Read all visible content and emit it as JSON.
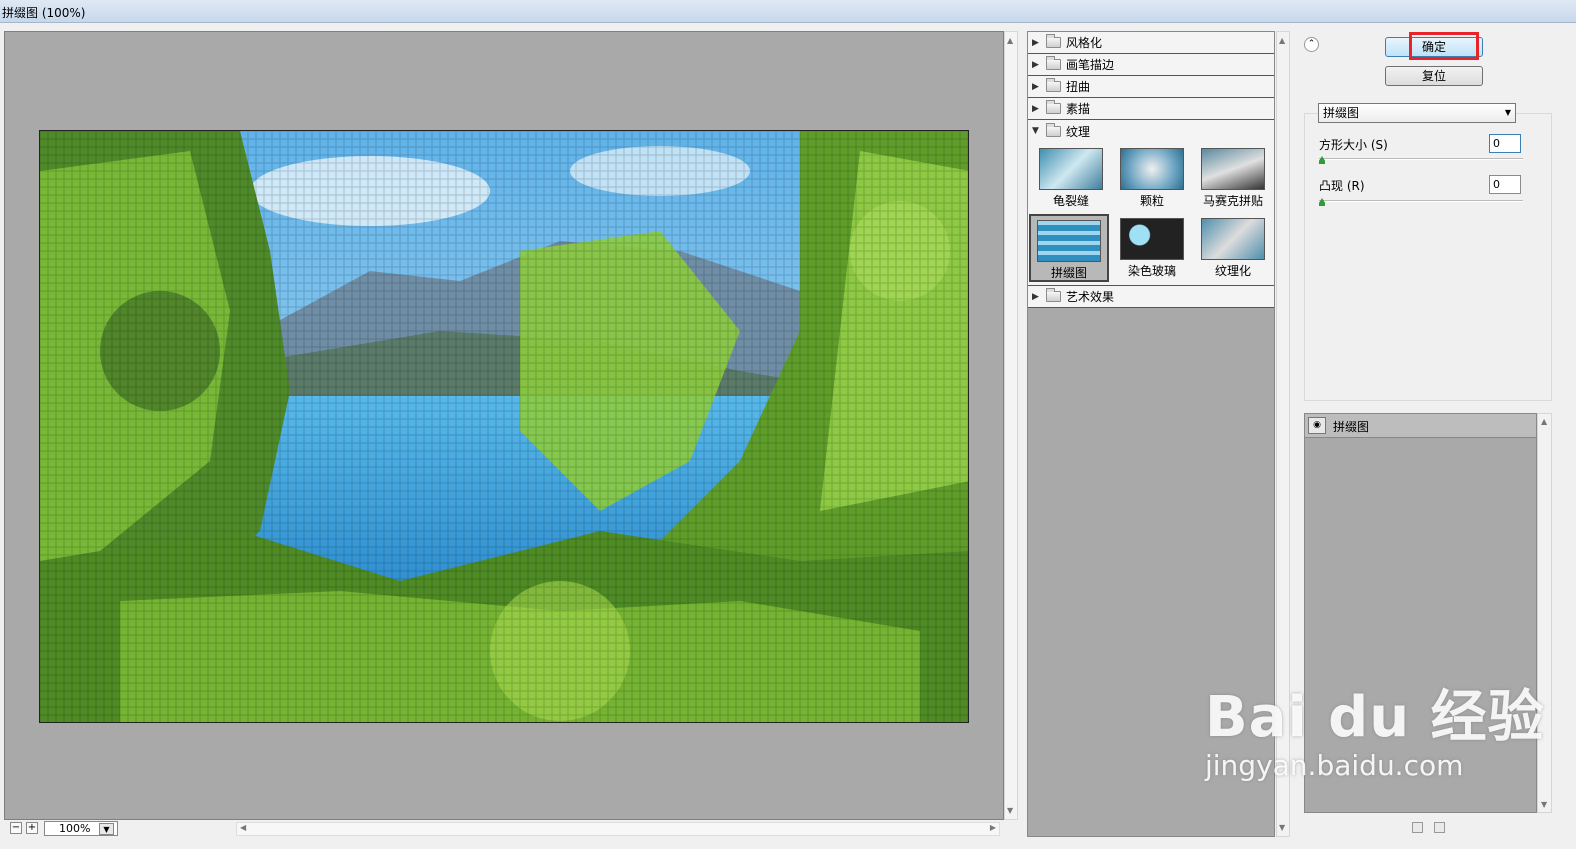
{
  "window": {
    "title": "拼缀图 (100%)"
  },
  "preview": {
    "zoom": "100%"
  },
  "gallery": {
    "categories": [
      {
        "label": "风格化"
      },
      {
        "label": "画笔描边"
      },
      {
        "label": "扭曲"
      },
      {
        "label": "素描"
      },
      {
        "label": "纹理"
      },
      {
        "label": "艺术效果"
      }
    ],
    "texture_filters": [
      "龟裂缝",
      "颗粒",
      "马赛克拼贴",
      "拼缀图",
      "染色玻璃",
      "纹理化"
    ],
    "selected_filter": "拼缀图"
  },
  "controls": {
    "ok_label": "确定",
    "reset_label": "复位",
    "filter_select": "拼缀图",
    "square_size_label": "方形大小 (S)",
    "square_size_value": "0",
    "relief_label": "凸现 (R)",
    "relief_value": "0"
  },
  "layers": {
    "items": [
      "拼缀图"
    ]
  },
  "watermark": {
    "brand": "Bai du 经验",
    "url": "jingyan.baidu.com"
  },
  "colors": {
    "highlight": "#e8242a",
    "panel_gray": "#a9a9a9"
  }
}
